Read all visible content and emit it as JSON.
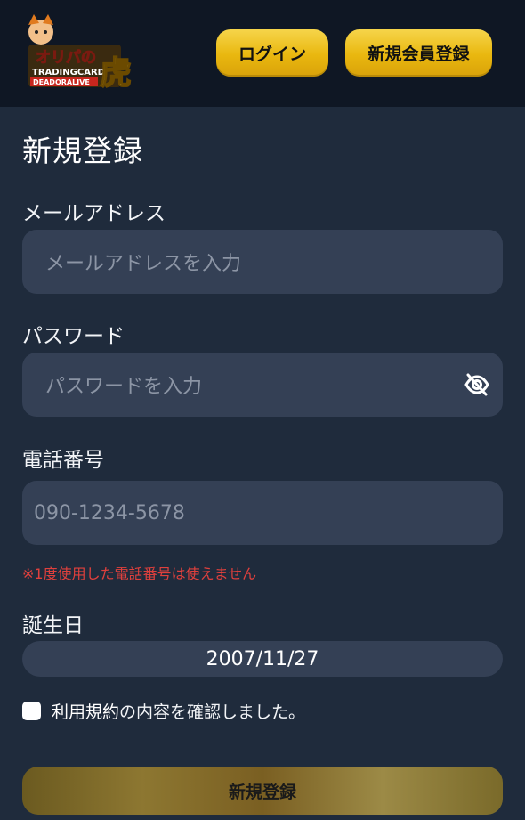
{
  "header": {
    "logo_text": "オリパの虎 TRADINGCARD DEADORALIVE",
    "login_label": "ログイン",
    "signup_label": "新規会員登録"
  },
  "form": {
    "title": "新規登録",
    "email": {
      "label": "メールアドレス",
      "placeholder": "メールアドレスを入力"
    },
    "password": {
      "label": "パスワード",
      "placeholder": "パスワードを入力",
      "toggle_icon": "eye-off-icon"
    },
    "phone": {
      "label": "電話番号",
      "placeholder": "090-1234-5678",
      "warning": "※1度使用した電話番号は使えません"
    },
    "birthday": {
      "label": "誕生日",
      "value": "2007/11/27"
    },
    "agree": {
      "link_text": "利用規約",
      "text": "の内容を確認しました。",
      "checked": false
    },
    "submit_label": "新規登録"
  },
  "colors": {
    "background": "#1f2b3c",
    "header_bg": "#0f1724",
    "field_bg": "#344055",
    "gold": "#e9b70f",
    "warning": "#e0403d"
  }
}
